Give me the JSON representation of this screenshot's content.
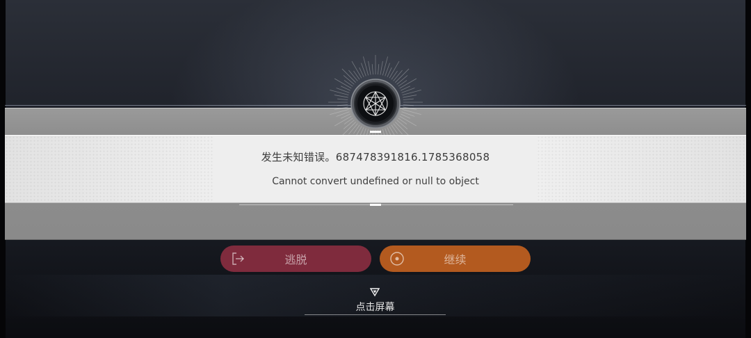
{
  "dialog": {
    "title": "发生未知错误。687478391816.1785368058",
    "message": "Cannot convert undefined or null to object"
  },
  "buttons": {
    "escape_label": "逃脱",
    "continue_label": "继续"
  },
  "tap_prompt": {
    "label": "点击屏幕"
  },
  "colors": {
    "escape_button": "#7f2b3d",
    "continue_button": "#b35a1f",
    "panel": "#eeeeee",
    "band": "#8f8f8f"
  },
  "icons": {
    "emblem": "crystal-emblem-icon",
    "escape": "exit-door-icon",
    "continue": "target-circle-icon",
    "tap": "down-triangle-icon"
  }
}
